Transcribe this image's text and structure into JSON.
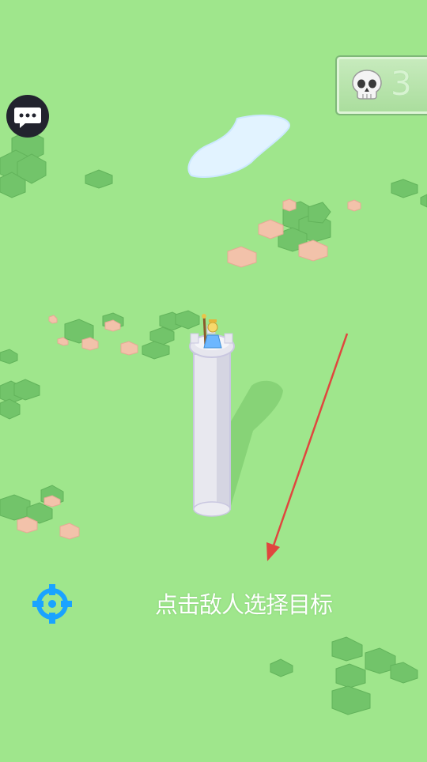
{
  "hud": {
    "kill_count": "3",
    "kill_icon": "skull-icon",
    "chat_icon": "chat-bubble-icon",
    "target_icon": "crosshair-icon",
    "hint": "点击敌人选择目标"
  },
  "colors": {
    "ground": "#9fe68c",
    "bush": "#6cbd63",
    "rock": "#f0bfa6",
    "water": "#dff1ff",
    "tower": "#e7e7ee",
    "arrow": "#e0463e",
    "target_accent": "#1aa3ff"
  }
}
